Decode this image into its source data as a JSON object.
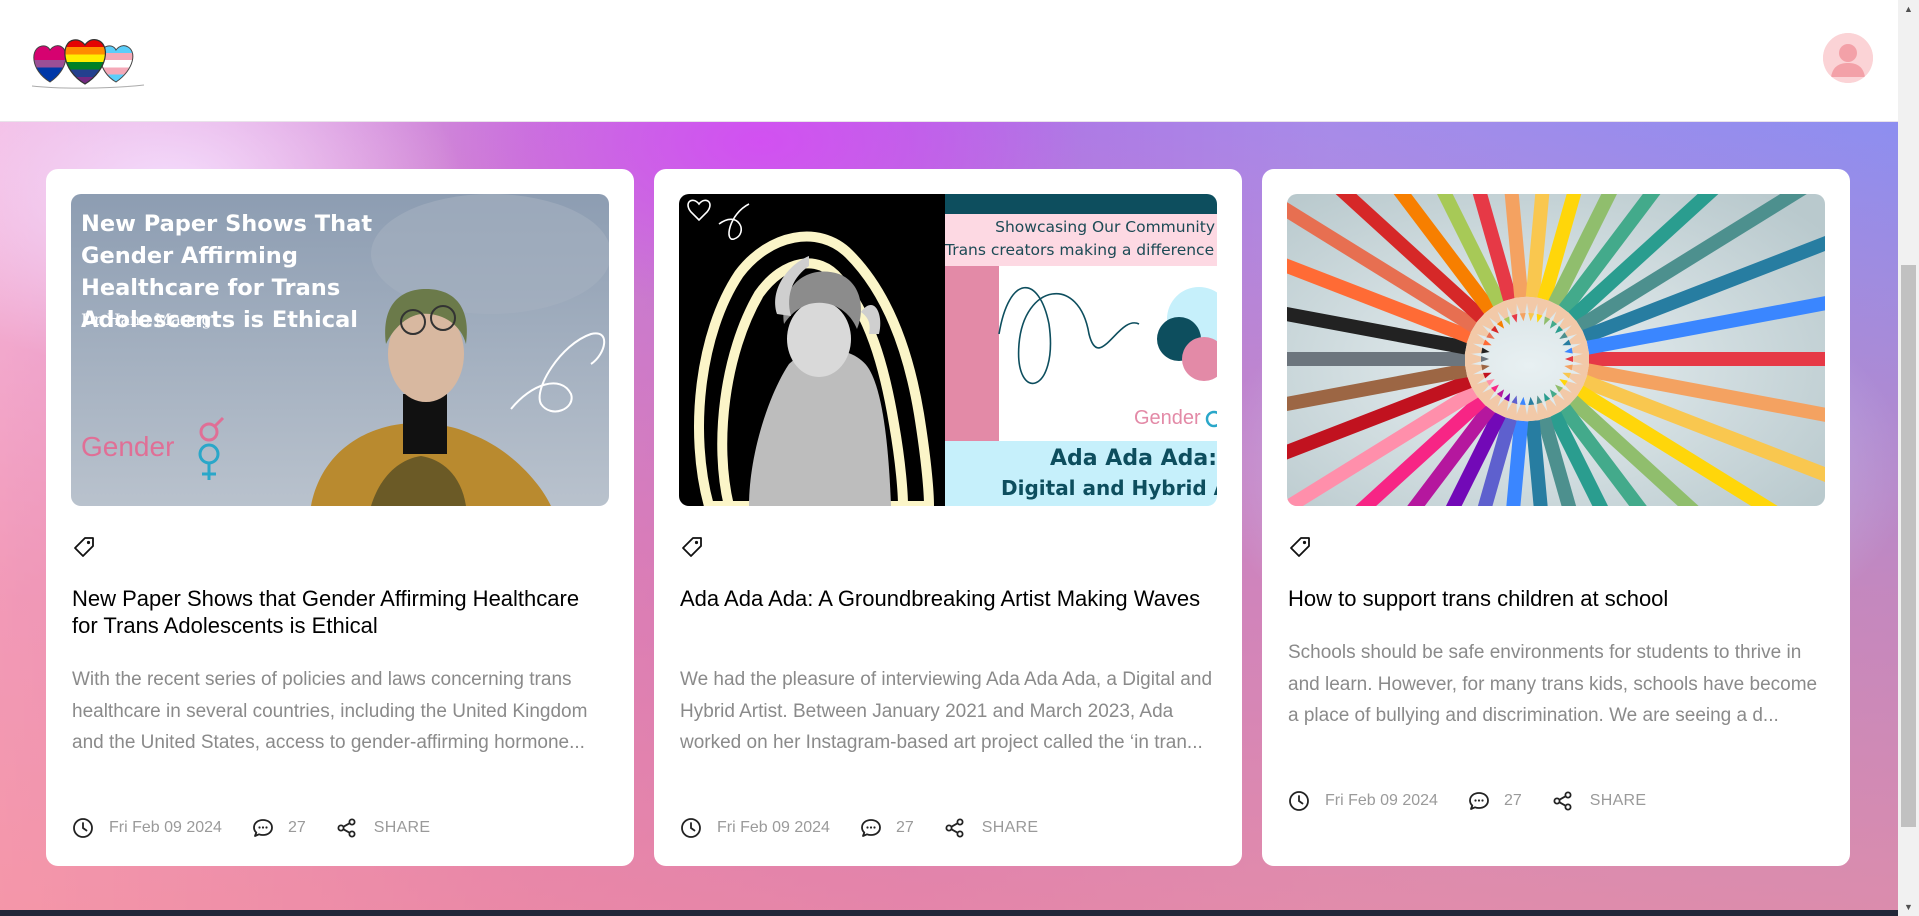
{
  "header": {
    "logo": "rainbow-hearts-logo",
    "avatar": "user-avatar-icon"
  },
  "colors": {
    "card_bg": "#ffffff",
    "title_text": "#000000",
    "excerpt_text": "#8a8a8a",
    "meta_text": "#9a9a9a",
    "brand_pink": "#e06f96",
    "brand_teal": "#0d4e5e"
  },
  "cards": [
    {
      "image": {
        "overlay_title": "New Paper Shows That Gender Affirming Healthcare for Trans Adolescents is Ethical",
        "overlay_author": "Dr Hane Maung",
        "brand": "Gender"
      },
      "tag_icon": "tag-icon",
      "title": "New Paper Shows that Gender Affirming Healthcare for Trans Adolescents is Ethical",
      "excerpt": "With the recent series of policies and laws concerning trans healthcare in several countries, including the United Kingdom and the United States, access to gender-affirming hormone...",
      "date": "Fri Feb 09 2024",
      "comments": "27",
      "share": "SHARE"
    },
    {
      "image": {
        "line1": "Showcasing Our Community",
        "line2": "Trans creators making a difference",
        "brand": "Gender",
        "headline1": "Ada Ada Ada:",
        "headline2": "Digital and Hybrid Artist"
      },
      "tag_icon": "tag-icon",
      "title": "Ada Ada Ada: A Groundbreaking Artist Making Waves",
      "excerpt": "We had the pleasure of interviewing Ada Ada Ada, a Digital and Hybrid Artist. Between January 2021 and March 2023, Ada worked on her Instagram-based art project called the ‘in tran...",
      "date": "Fri Feb 09 2024",
      "comments": "27",
      "share": "SHARE"
    },
    {
      "image": {
        "subject": "colored-pencils-circle"
      },
      "tag_icon": "tag-icon",
      "title": "How to support trans children at school",
      "excerpt": "Schools should be safe environments for students to thrive in and learn. However, for many trans kids, schools have become a place of bullying and discrimination. We are seeing a d...",
      "date": "Fri Feb 09 2024",
      "comments": "27",
      "share": "SHARE"
    }
  ]
}
